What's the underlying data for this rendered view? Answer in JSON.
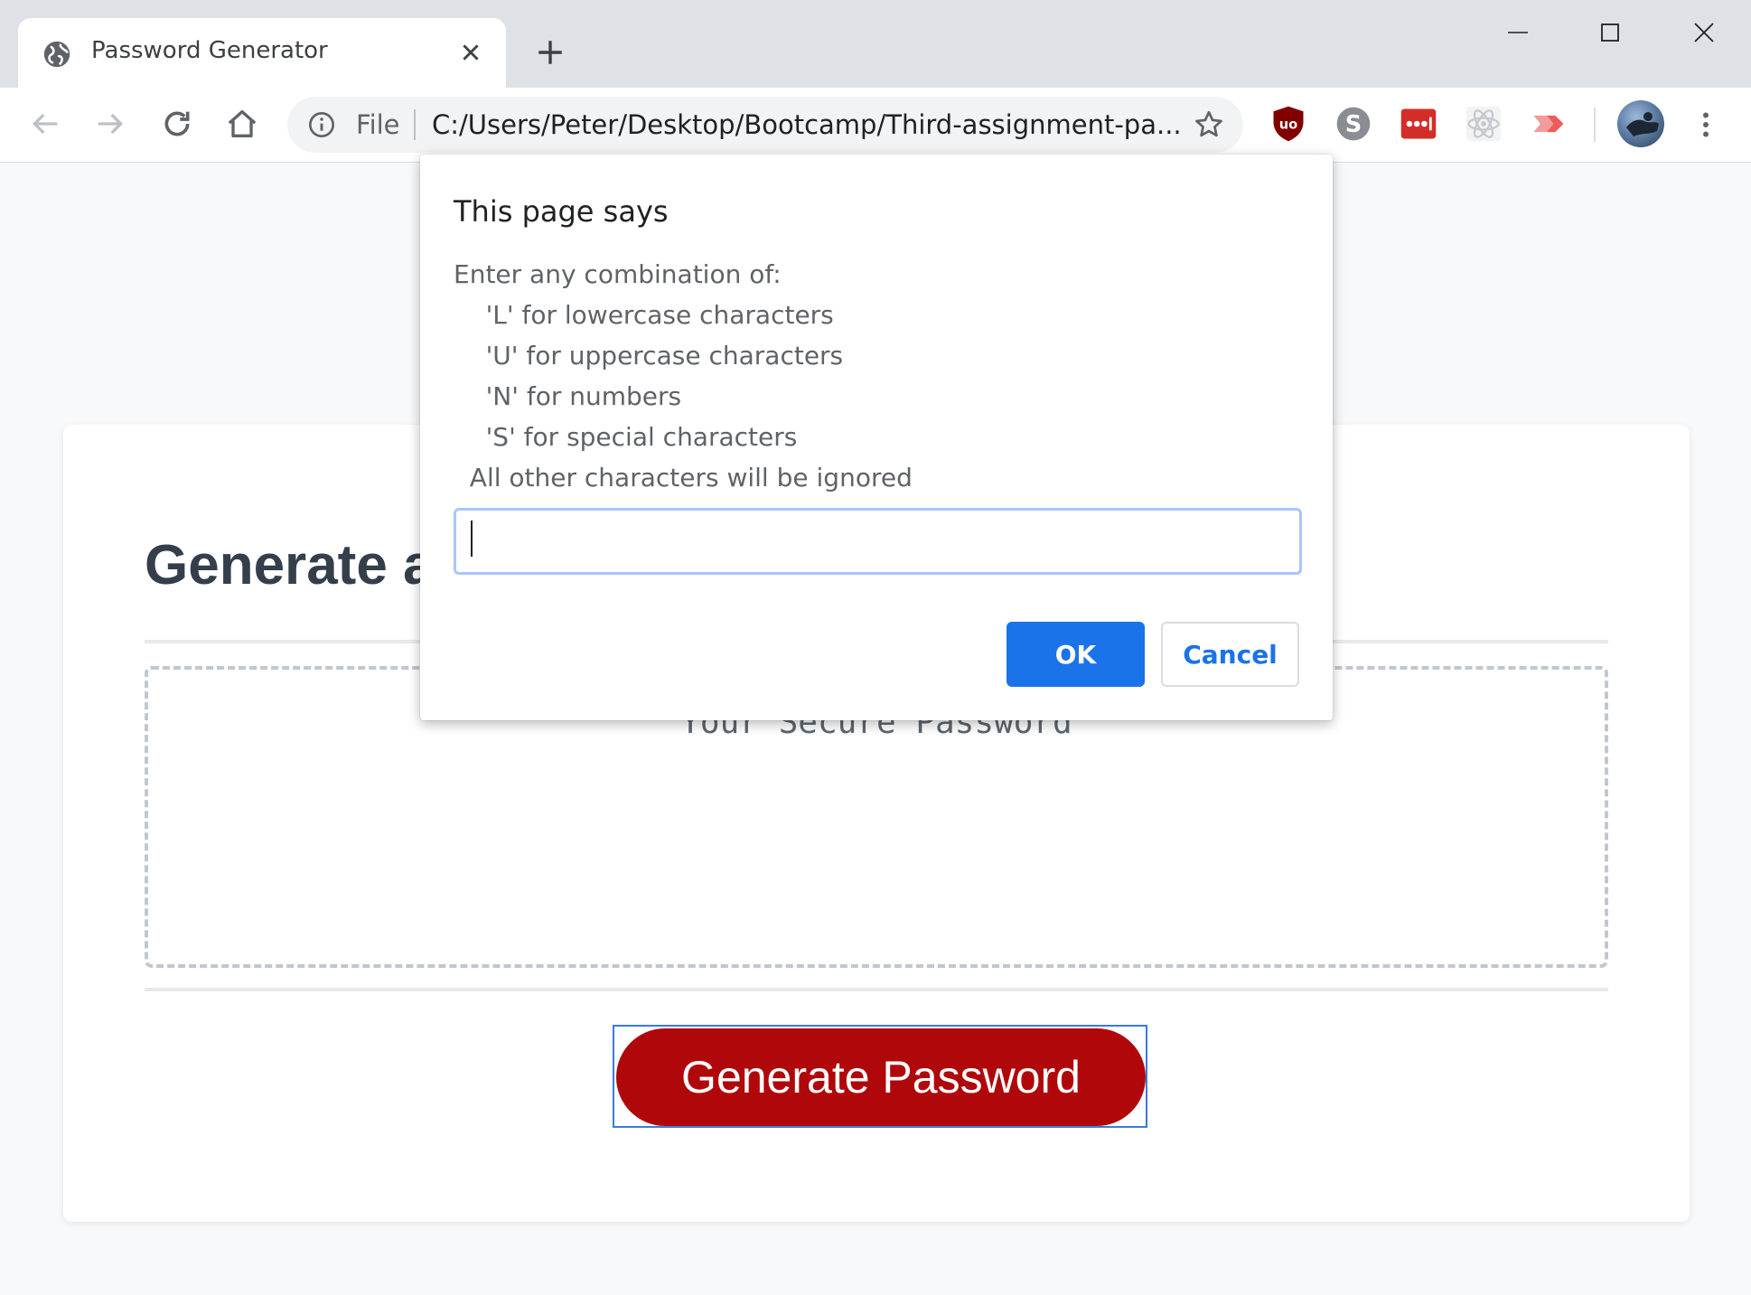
{
  "browser": {
    "tab_title": "Password Generator",
    "address_scheme": "File",
    "address_url": "C:/Users/Peter/Desktop/Bootcamp/Third-assignment-pa...",
    "accent_color": "#1a73e8"
  },
  "page": {
    "heading": "Generate a Password",
    "password_placeholder": "Your Secure Password",
    "generate_button": "Generate Password",
    "button_color": "#b0080a"
  },
  "dialog": {
    "title": "This page says",
    "message_lines": [
      "Enter any combination of:",
      "    'L' for lowercase characters",
      "    'U' for uppercase characters",
      "    'N' for numbers",
      "    'S' for special characters",
      "  All other characters will be ignored"
    ],
    "input_value": "",
    "ok_label": "OK",
    "cancel_label": "Cancel"
  },
  "icons": {
    "tab_favicon": "globe-icon",
    "extensions": [
      "ublock-origin-icon",
      "skype-icon",
      "lastpass-icon",
      "react-devtools-icon",
      "cast-icon"
    ]
  }
}
